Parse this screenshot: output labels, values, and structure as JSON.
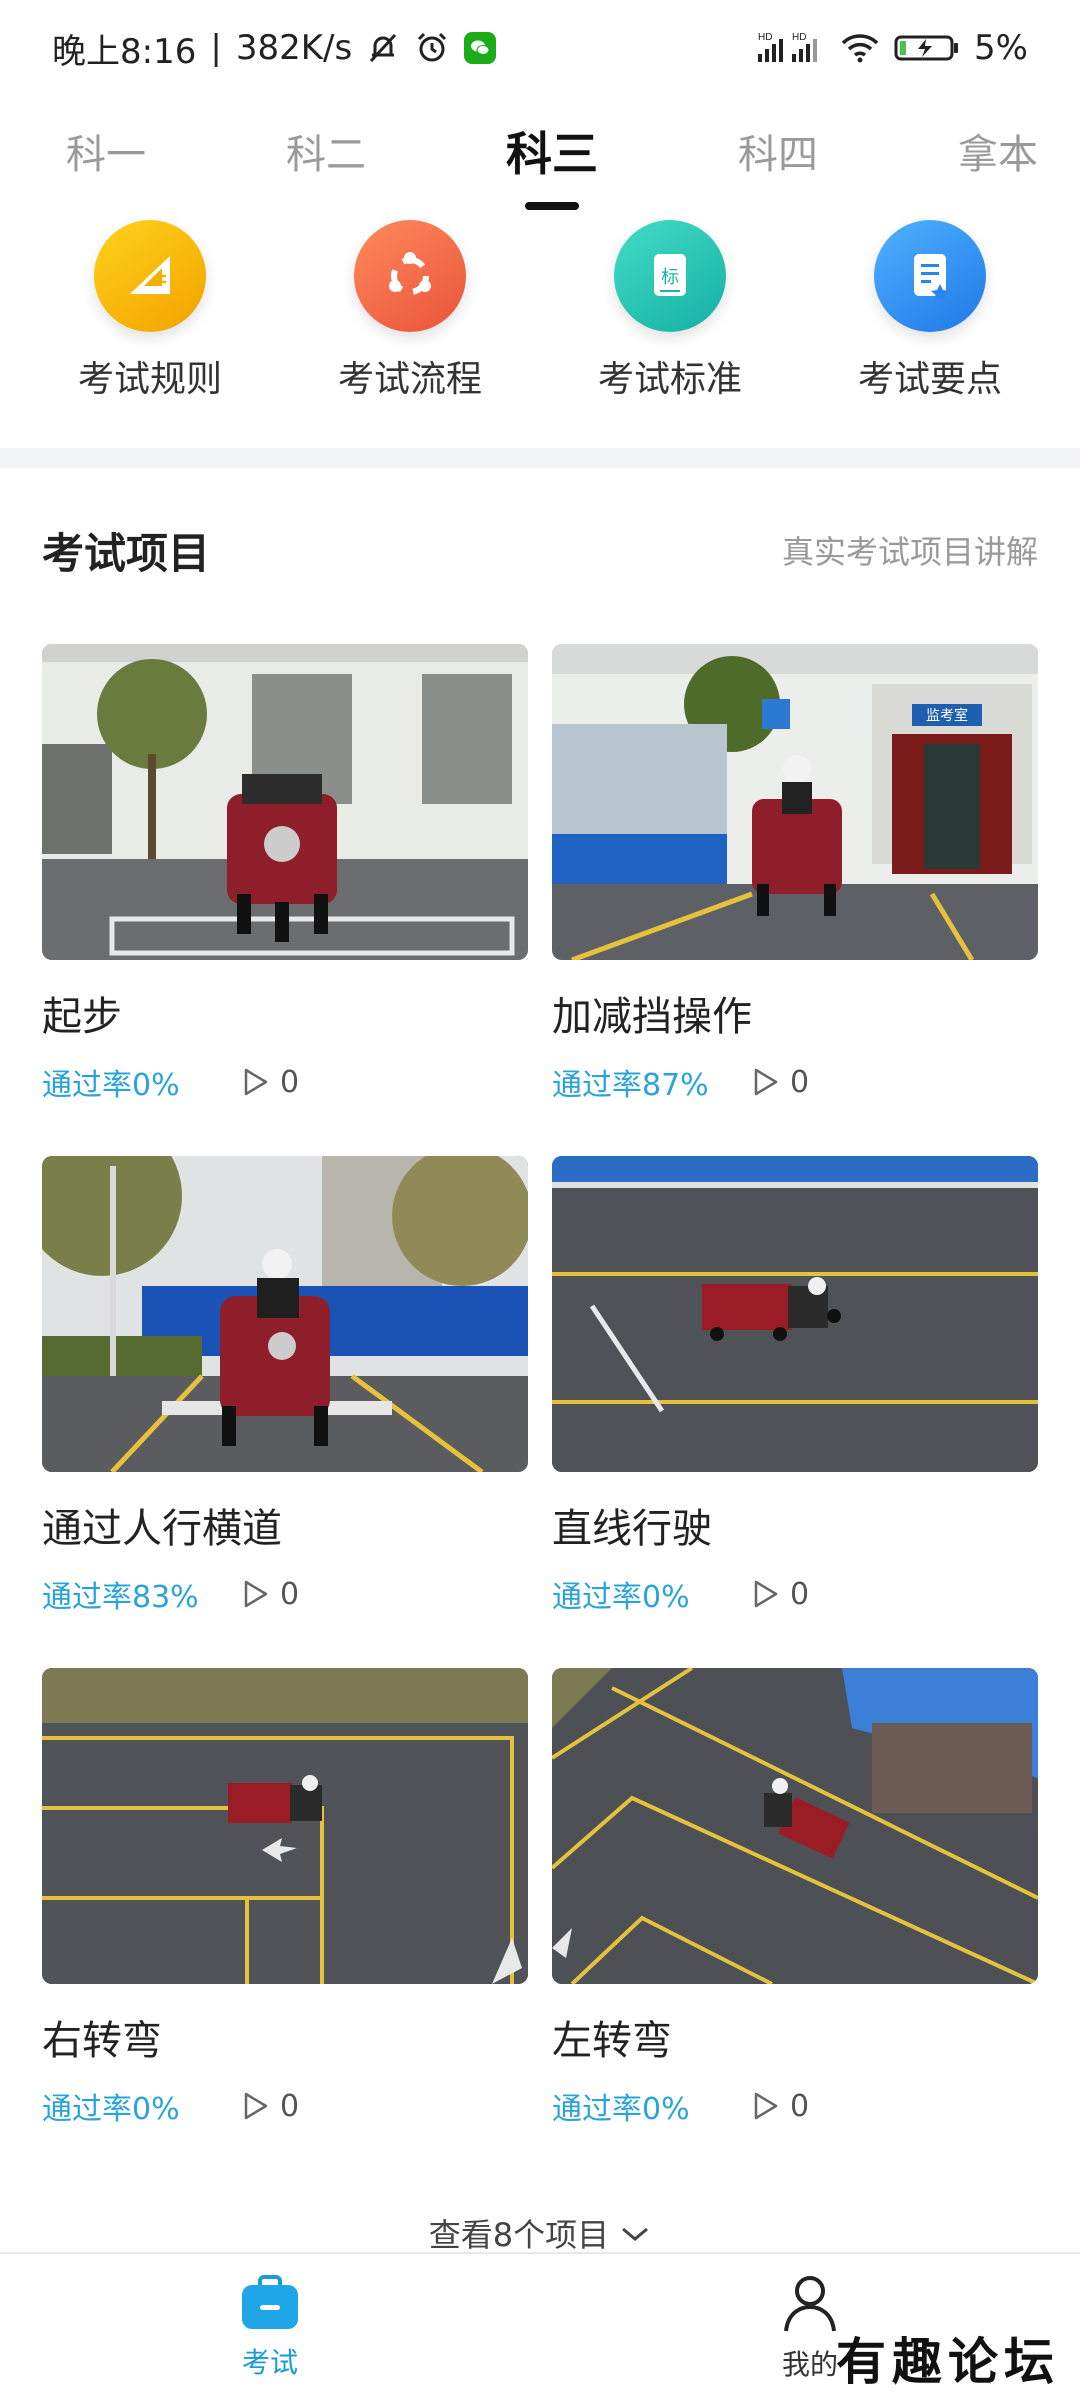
{
  "status_bar": {
    "time": "晚上8:16",
    "speed": "382K/s",
    "battery": "5%",
    "icons": [
      "bell-mute-icon",
      "alarm-icon",
      "wechat-icon",
      "signal-icon",
      "wifi-icon",
      "battery-icon"
    ]
  },
  "tabs": [
    {
      "label": "科一"
    },
    {
      "label": "科二"
    },
    {
      "label": "科三"
    },
    {
      "label": "科四"
    },
    {
      "label": "拿本"
    }
  ],
  "active_tab": "科三",
  "quick_menu": [
    {
      "label": "考试规则",
      "icon": "ruler-icon",
      "color": "#f5b400"
    },
    {
      "label": "考试流程",
      "icon": "cycle-icon",
      "color": "#f06a43"
    },
    {
      "label": "考试标准",
      "icon": "standard-doc-icon",
      "icon_text": "标",
      "color": "#24c2b2"
    },
    {
      "label": "考试要点",
      "icon": "note-icon",
      "color": "#2b8ef0"
    }
  ],
  "section": {
    "title": "考试项目",
    "link": "真实考试项目讲解"
  },
  "items": [
    {
      "title": "起步",
      "pass_rate": "通过率0%",
      "plays": "0"
    },
    {
      "title": "加减挡操作",
      "pass_rate": "通过率87%",
      "plays": "0"
    },
    {
      "title": "通过人行横道",
      "pass_rate": "通过率83%",
      "plays": "0"
    },
    {
      "title": "直线行驶",
      "pass_rate": "通过率0%",
      "plays": "0"
    },
    {
      "title": "右转弯",
      "pass_rate": "通过率0%",
      "plays": "0"
    },
    {
      "title": "左转弯",
      "pass_rate": "通过率0%",
      "plays": "0"
    }
  ],
  "thumb_text": {
    "exam_room_sign": "监考室"
  },
  "more": {
    "label": "查看8个项目"
  },
  "bottom_nav": [
    {
      "label": "考试",
      "active": true
    },
    {
      "label": "我的",
      "active": false
    }
  ],
  "watermark": "有趣论坛",
  "colors": {
    "accent": "#1a9bd6",
    "pass_rate": "#2aa4d8",
    "divider": "#f1f3f6"
  }
}
